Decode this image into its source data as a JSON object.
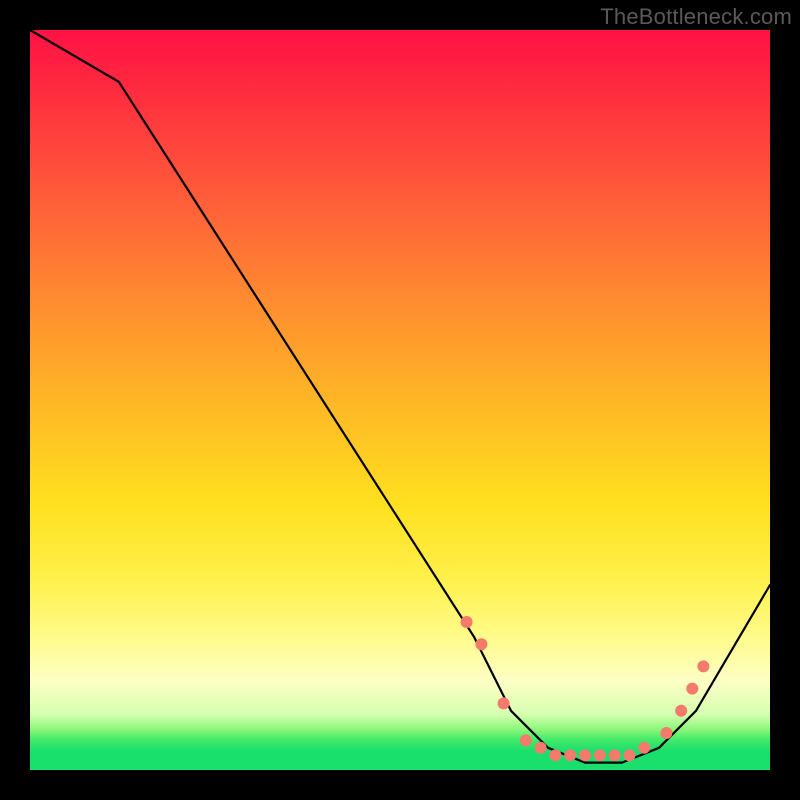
{
  "watermark": "TheBottleneck.com",
  "chart_data": {
    "type": "line",
    "title": "",
    "xlabel": "",
    "ylabel": "",
    "xlim": [
      0,
      100
    ],
    "ylim": [
      0,
      100
    ],
    "series": [
      {
        "name": "bottleneck-curve",
        "x": [
          0,
          12,
          60,
          65,
          70,
          75,
          80,
          85,
          90,
          100
        ],
        "y": [
          100,
          93,
          18,
          8,
          3,
          1,
          1,
          3,
          8,
          25
        ]
      }
    ],
    "markers": {
      "name": "curve-markers",
      "color": "#f47a6b",
      "x": [
        59,
        61,
        64,
        67,
        69,
        71,
        73,
        75,
        77,
        79,
        81,
        83,
        86,
        88,
        89.5,
        91
      ],
      "y": [
        20,
        17,
        9,
        4,
        3,
        2,
        2,
        2,
        2,
        2,
        2,
        3,
        5,
        8,
        11,
        14
      ]
    },
    "gradient_stops": [
      {
        "pos": 0.0,
        "color": "#ff1244"
      },
      {
        "pos": 0.5,
        "color": "#ffe01f"
      },
      {
        "pos": 0.9,
        "color": "#fdffc4"
      },
      {
        "pos": 0.96,
        "color": "#3fe96a"
      },
      {
        "pos": 1.0,
        "color": "#19df6c"
      }
    ]
  }
}
